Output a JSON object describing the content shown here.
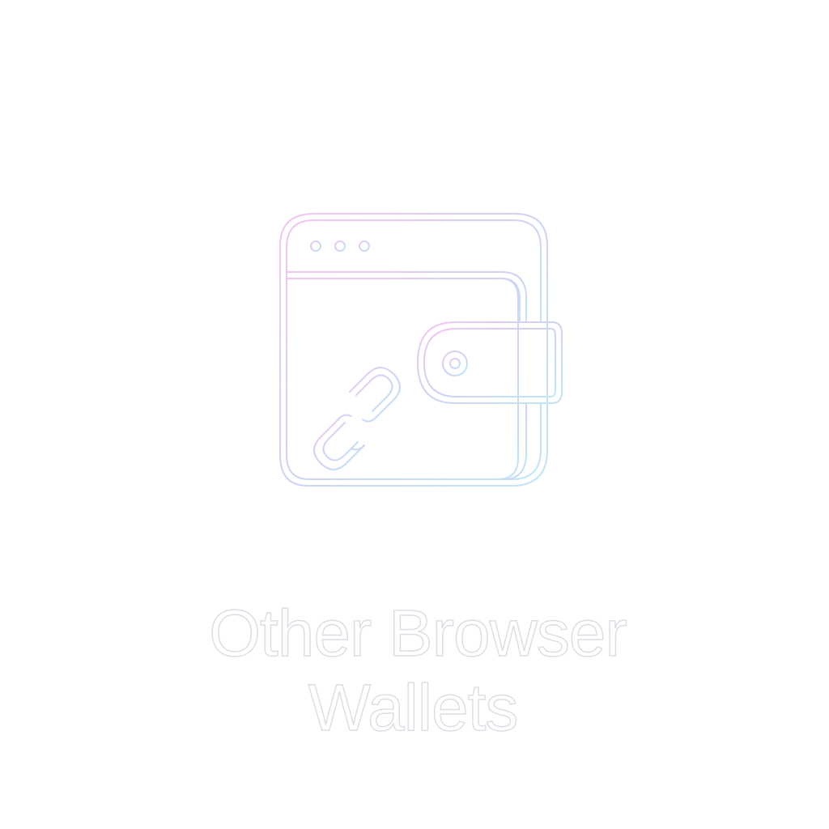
{
  "icon": {
    "name": "browser-wallet-link-icon",
    "stroke_gradient": [
      "#f3c6f0",
      "#cfd2f6",
      "#bfe6f7"
    ]
  },
  "title": {
    "line1": "Other Browser",
    "line2": "Wallets"
  }
}
